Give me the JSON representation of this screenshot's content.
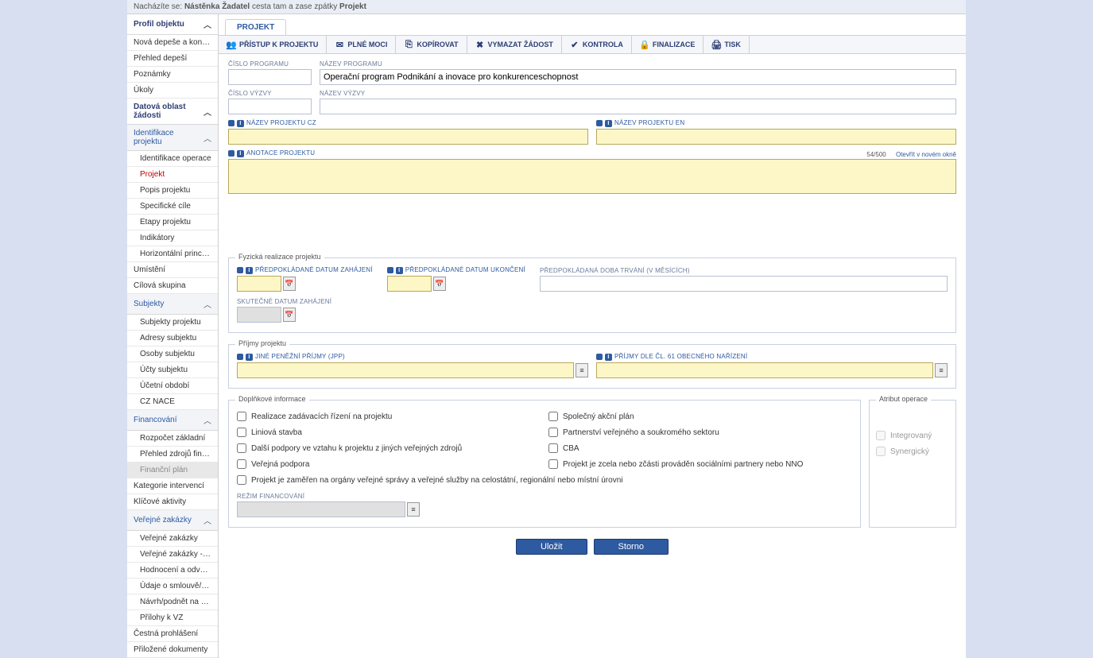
{
  "breadcrumb": {
    "label": "Nacházíte se:",
    "items": [
      "Nástěnka",
      "Žadatel",
      "cesta tam a zase zpátky",
      "Projekt"
    ]
  },
  "sidebar": {
    "s1": {
      "title": "Profil objektu"
    },
    "i_nova_depese": "Nová depeše a koncepty",
    "i_prehled_depesi": "Přehled depeší",
    "i_poznamky": "Poznámky",
    "i_ukoly": "Úkoly",
    "s2": {
      "title": "Datová oblast žádosti"
    },
    "s3": {
      "title": "Identifikace projektu"
    },
    "i_ident_operace": "Identifikace operace",
    "i_projekt": "Projekt",
    "i_popis": "Popis projektu",
    "i_spec_cile": "Specifické cíle",
    "i_etapy": "Etapy projektu",
    "i_indikatory": "Indikátory",
    "i_horiz": "Horizontální principy",
    "i_umisteni": "Umístění",
    "i_cilova": "Cílová skupina",
    "s4": {
      "title": "Subjekty"
    },
    "i_subj_proj": "Subjekty projektu",
    "i_adresy": "Adresy subjektu",
    "i_osoby": "Osoby subjektu",
    "i_ucty": "Účty subjektu",
    "i_ucetni": "Účetní období",
    "i_cznace": "CZ NACE",
    "s5": {
      "title": "Financování"
    },
    "i_rozpocet": "Rozpočet základní",
    "i_prehled_zdroju": "Přehled zdrojů financování",
    "i_fin_plan": "Finanční plán",
    "i_kategorie": "Kategorie intervencí",
    "i_klicove": "Klíčové aktivity",
    "s6": {
      "title": "Veřejné zakázky"
    },
    "i_vz": "Veřejné zakázky",
    "i_vz_etapy": "Veřejné zakázky - etapy",
    "i_hodnoceni": "Hodnocení a odvolání",
    "i_udaje_sml": "Údaje o smlouvě/dodatku",
    "i_navrh_uohs": "Návrh/podnět na ÚOHS",
    "i_prilohy_vz": "Přílohy k VZ",
    "i_cestna": "Čestná prohlášení",
    "i_prilozene": "Přiložené dokumenty"
  },
  "tab": {
    "label": "PROJEKT"
  },
  "toolbar": {
    "pristup": "PŘÍSTUP K PROJEKTU",
    "plne_moci": "PLNÉ MOCI",
    "kopirovat": "KOPÍROVAT",
    "vymazat": "VYMAZAT ŽÁDOST",
    "kontrola": "KONTROLA",
    "finalizace": "FINALIZACE",
    "tisk": "TISK"
  },
  "form": {
    "cislo_programu_lbl": "ČÍSLO PROGRAMU",
    "nazev_programu_lbl": "NÁZEV PROGRAMU",
    "nazev_programu_val": "Operační program Podnikání a inovace pro konkurenceschopnost",
    "cislo_vyzvy_lbl": "ČÍSLO VÝZVY",
    "nazev_vyzvy_lbl": "NÁZEV VÝZVY",
    "nazev_proj_cz_lbl": "NÁZEV PROJEKTU CZ",
    "nazev_proj_en_lbl": "NÁZEV PROJEKTU EN",
    "anotace_lbl": "ANOTACE PROJEKTU",
    "anotace_counter": "54/500",
    "anotace_link": "Otevřít v novém okně",
    "fyz_legend": "Fyzická realizace projektu",
    "dat_zahajeni_lbl": "PŘEDPOKLÁDANÉ DATUM ZAHÁJENÍ",
    "dat_ukonceni_lbl": "PŘEDPOKLÁDANÉ DATUM UKONČENÍ",
    "doba_trvani_lbl": "PŘEDPOKLÁDANÁ DOBA TRVÁNÍ (V MĚSÍCÍCH)",
    "skut_zahajeni_lbl": "SKUTEČNÉ DATUM ZAHÁJENÍ",
    "prijmy_legend": "Příjmy projektu",
    "jpp_lbl": "JINÉ PENĚŽNÍ PŘÍJMY (JPP)",
    "prijmy61_lbl": "PŘÍJMY DLE ČL. 61 OBECNÉHO NAŘÍZENÍ",
    "doplnkove_legend": "Doplňkové informace",
    "atribut_legend": "Atribut operace",
    "cb_realizace": "Realizace zadávacích řízení na projektu",
    "cb_liniova": "Liniová stavba",
    "cb_dalsi_podpory": "Další podpory ve vztahu k projektu z jiných veřejných zdrojů",
    "cb_verejna_podpora": "Veřejná podpora",
    "cb_spolecny_plan": "Společný akční plán",
    "cb_partnerstvi": "Partnerství veřejného a soukromého sektoru",
    "cb_cba": "CBA",
    "cb_nno": "Projekt je zcela nebo zčásti prováděn sociálními partnery nebo NNO",
    "cb_organy": "Projekt je zaměřen na orgány veřejné správy a veřejné služby na celostátní, regionální nebo místní úrovni",
    "cb_integrovany": "Integrovaný",
    "cb_synergicky": "Synergický",
    "rezim_lbl": "REŽIM FINANCOVÁNÍ"
  },
  "buttons": {
    "save": "Uložit",
    "cancel": "Storno"
  }
}
